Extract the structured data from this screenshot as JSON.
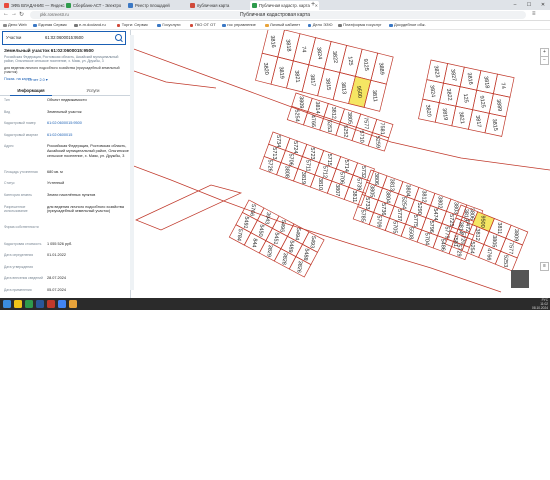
{
  "browser": {
    "tabs": [
      {
        "label": "ЭФБ ВЛАДАНИЕ — Яндекс",
        "color": "#e84a3c"
      },
      {
        "label": "Сбербанк-АСТ - Электро",
        "color": "#2e9b4c"
      },
      {
        "label": "Реестр площадей",
        "color": "#3b78c4"
      },
      {
        "label": "публичная карта",
        "color": "#d04a3a"
      },
      {
        "label": "Публичная кадастр. карта",
        "color": "#2e9b4c"
      }
    ],
    "new_tab": "+",
    "address": "pkk.rosreestr.ru",
    "bookmarks": [
      {
        "label": "Дело Web",
        "color": "#888"
      },
      {
        "label": "Единая Сервис",
        "color": "#3b78c4"
      },
      {
        "label": "e-m.docland.ru",
        "color": "#777"
      },
      {
        "label": "Торги: Сервис",
        "color": "#d04a3a"
      },
      {
        "label": "Госуслуги",
        "color": "#3b78c4"
      },
      {
        "label": "ГКО ОТ ОТ",
        "color": "#d04a3a"
      },
      {
        "label": "гос управление",
        "color": "#3b78c4"
      },
      {
        "label": "Личный кабинет",
        "color": "#e8a33a"
      },
      {
        "label": "Дело ЭЗЮ",
        "color": "#3b78c4"
      },
      {
        "label": "Платформа госуслуг",
        "color": "#777"
      },
      {
        "label": "Досудебное обж.",
        "color": "#3b78c4"
      }
    ]
  },
  "map_title": "Публичная кадастровая карта",
  "panel": {
    "search_type": "Участки",
    "search_value": "61:02:0600015:9500",
    "title": "Земельный участок 61:02:0600015:9500",
    "address": "Российская Федерация, Ростовская область, Аксайский муниципальный район, Ольгинское сельское поселение, х. Маяк, ул. Дружбы, 3",
    "type_line": "для ведения личного подсобного хозяйства (приусадебный земельный участок)",
    "show_on_map": "Показ. на карте",
    "export": "Отчет 2.0 ▾",
    "tab_info": "Информация",
    "tab_services": "Услуги",
    "rows": [
      {
        "k": "Тип",
        "v": "Объект недвижимости"
      },
      {
        "k": "Вид",
        "v": "Земельный участок"
      },
      {
        "k": "Кадастровый номер",
        "v": "61:02:0600015:9500",
        "link": true
      },
      {
        "k": "Кадастровый квартал",
        "v": "61:02:0600015",
        "link": true
      },
      {
        "k": "Адрес",
        "v": "Российская Федерация, Ростовская область, Аксайский муниципальный район, Ольгинское сельское поселение, х. Маяк, ул. Дружбы, 3"
      },
      {
        "k": "Площадь уточненная",
        "v": "680 кв. м"
      },
      {
        "k": "Статус",
        "v": "Учтенный"
      },
      {
        "k": "Категория земель",
        "v": "Земли населённых пунктов"
      },
      {
        "k": "Разрешенное использование",
        "v": "для ведения личного подсобного хозяйства (приусадебный земельный участок)"
      },
      {
        "k": "Форма собственности",
        "v": ""
      },
      {
        "k": "Кадастровая стоимость",
        "v": "1 055 526 руб."
      },
      {
        "k": "Дата определения",
        "v": "01.01.2022"
      },
      {
        "k": "Дата утверждения",
        "v": ""
      },
      {
        "k": "Дата внесения сведений",
        "v": "28.07.2024"
      },
      {
        "k": "Дата применения",
        "v": "05.07.2024"
      }
    ]
  },
  "parcels": [
    "3816",
    "3818",
    "74",
    "3824",
    "3822",
    "125",
    "9125",
    "3889",
    "3820",
    "3819",
    "3821",
    "3817",
    "3815",
    "3813",
    "9500",
    "3811",
    "3809",
    "3814",
    "3812",
    "3805",
    "7577",
    "7581",
    "5254",
    "4766",
    "5253",
    "5252",
    "5710",
    "5259",
    "5734",
    "5724",
    "5723",
    "5715",
    "5714",
    "5732",
    "5713",
    "5706",
    "5711",
    "5712",
    "5706",
    "5739",
    "5726",
    "3808",
    "3819",
    "3810",
    "3807",
    "3811",
    "3806",
    "3813",
    "3804",
    "3812",
    "3802",
    "3803",
    "3806",
    "3805",
    "3804",
    "5254",
    "5290",
    "5474",
    "5725",
    "5472",
    "5733",
    "5736",
    "5737",
    "5775",
    "5796",
    "5779",
    "5720",
    "5785",
    "5709",
    "5705",
    "5508",
    "5704",
    "5486",
    "5729",
    "5766",
    "3943",
    "5495",
    "5494",
    "5493",
    "5491",
    "5450",
    "5451",
    "5489",
    "5488",
    "5784",
    "844",
    "3829",
    "3828",
    "3826",
    "3823",
    "3827"
  ],
  "taskbar": {
    "time": "11:02",
    "date": "08.10.2024",
    "lang": "РУС"
  }
}
